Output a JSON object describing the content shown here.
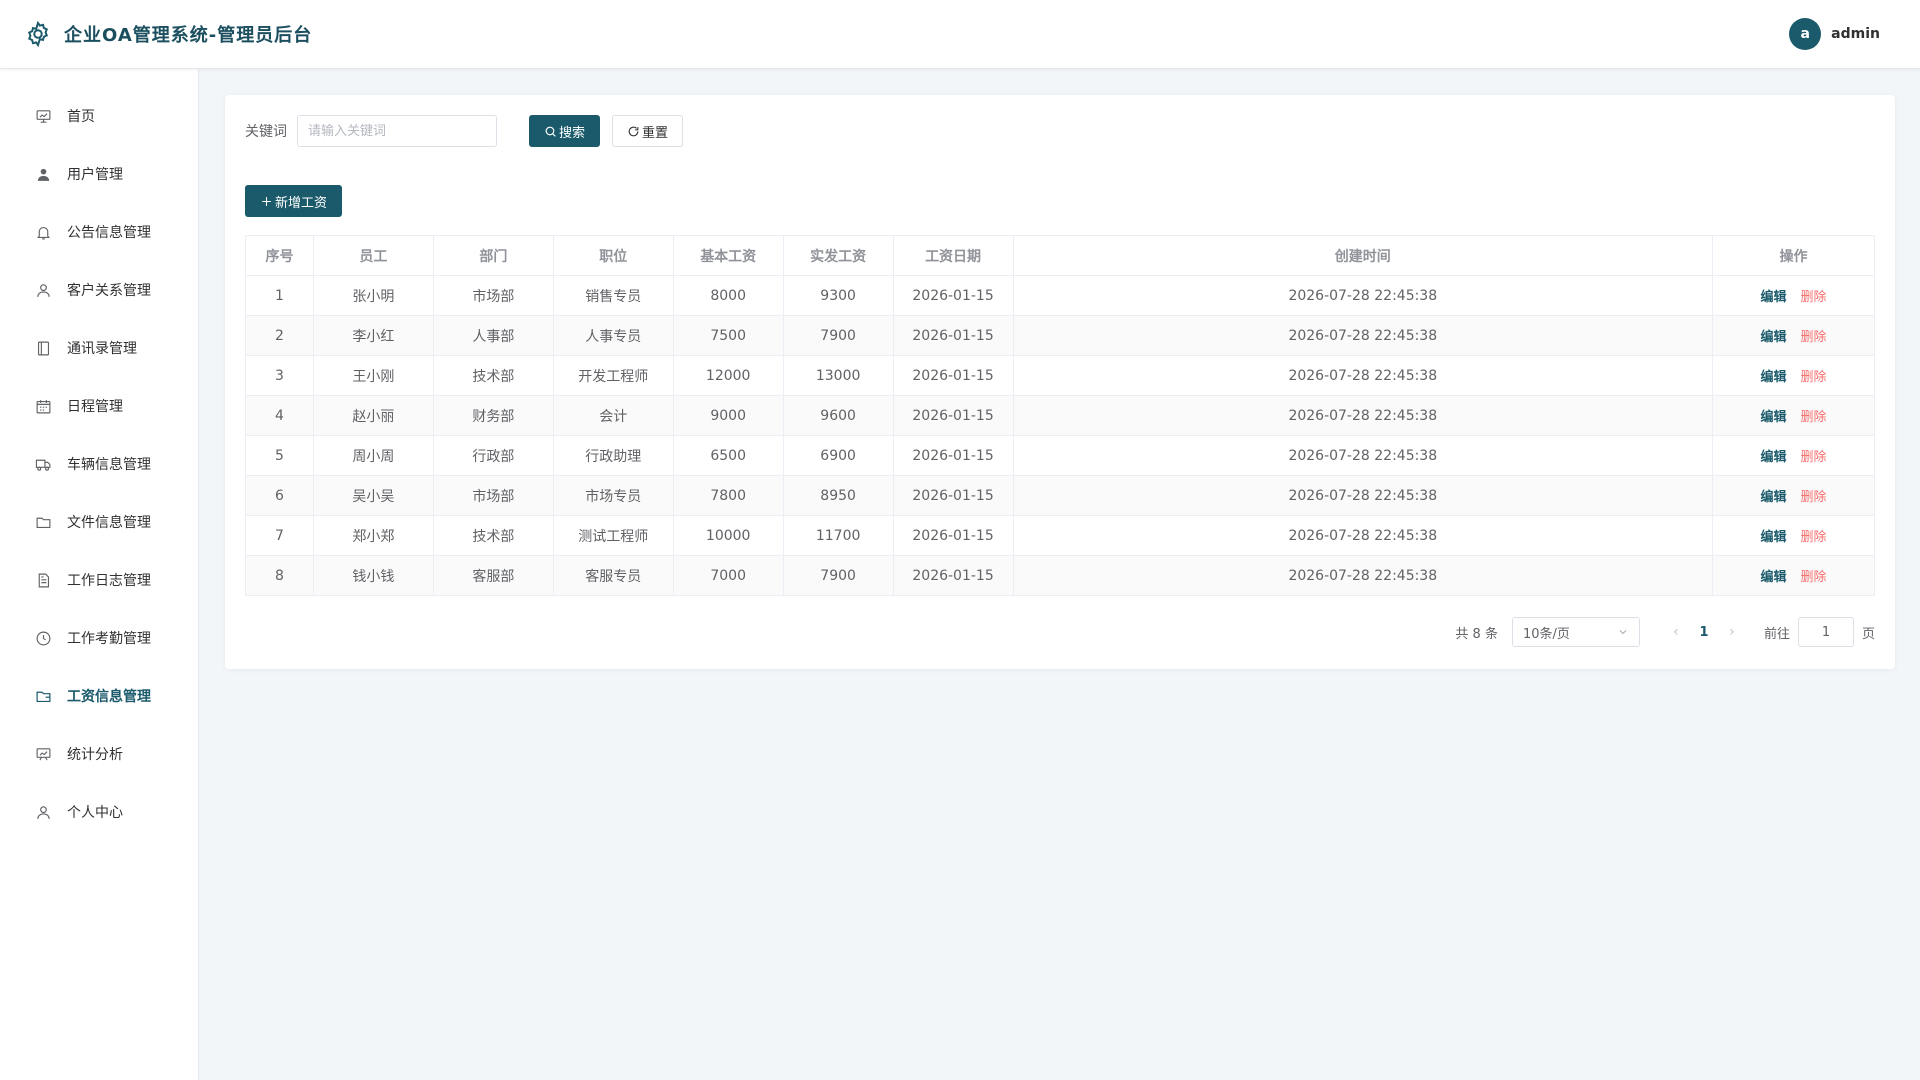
{
  "header": {
    "title": "企业OA管理系统-管理员后台",
    "avatar_letter": "a",
    "username": "admin"
  },
  "sidebar": {
    "items": [
      {
        "label": "首页",
        "icon": "dashboard-icon"
      },
      {
        "label": "用户管理",
        "icon": "user-icon"
      },
      {
        "label": "公告信息管理",
        "icon": "bell-icon"
      },
      {
        "label": "客户关系管理",
        "icon": "person-icon"
      },
      {
        "label": "通讯录管理",
        "icon": "notebook-icon"
      },
      {
        "label": "日程管理",
        "icon": "calendar-icon"
      },
      {
        "label": "车辆信息管理",
        "icon": "truck-icon"
      },
      {
        "label": "文件信息管理",
        "icon": "folder-icon"
      },
      {
        "label": "工作日志管理",
        "icon": "document-icon"
      },
      {
        "label": "工作考勤管理",
        "icon": "clock-icon"
      },
      {
        "label": "工资信息管理",
        "icon": "wallet-folder-icon",
        "active": true
      },
      {
        "label": "统计分析",
        "icon": "chart-board-icon"
      },
      {
        "label": "个人中心",
        "icon": "profile-icon"
      }
    ]
  },
  "search": {
    "label": "关键词",
    "placeholder": "请输入关键词",
    "value": "",
    "search_label": "搜索",
    "reset_label": "重置"
  },
  "toolbar": {
    "add_label": "新增工资"
  },
  "table": {
    "columns": [
      "序号",
      "员工",
      "部门",
      "职位",
      "基本工资",
      "实发工资",
      "工资日期",
      "创建时间",
      "操作"
    ],
    "edit_label": "编辑",
    "delete_label": "删除",
    "rows": [
      [
        "1",
        "张小明",
        "市场部",
        "销售专员",
        "8000",
        "9300",
        "2026-01-15",
        "2026-07-28 22:45:38"
      ],
      [
        "2",
        "李小红",
        "人事部",
        "人事专员",
        "7500",
        "7900",
        "2026-01-15",
        "2026-07-28 22:45:38"
      ],
      [
        "3",
        "王小刚",
        "技术部",
        "开发工程师",
        "12000",
        "13000",
        "2026-01-15",
        "2026-07-28 22:45:38"
      ],
      [
        "4",
        "赵小丽",
        "财务部",
        "会计",
        "9000",
        "9600",
        "2026-01-15",
        "2026-07-28 22:45:38"
      ],
      [
        "5",
        "周小周",
        "行政部",
        "行政助理",
        "6500",
        "6900",
        "2026-01-15",
        "2026-07-28 22:45:38"
      ],
      [
        "6",
        "吴小吴",
        "市场部",
        "市场专员",
        "7800",
        "8950",
        "2026-01-15",
        "2026-07-28 22:45:38"
      ],
      [
        "7",
        "郑小郑",
        "技术部",
        "测试工程师",
        "10000",
        "11700",
        "2026-01-15",
        "2026-07-28 22:45:38"
      ],
      [
        "8",
        "钱小钱",
        "客服部",
        "客服专员",
        "7000",
        "7900",
        "2026-01-15",
        "2026-07-28 22:45:38"
      ]
    ]
  },
  "pagination": {
    "total_text": "共 8 条",
    "page_size": "10条/页",
    "current_page": "1",
    "goto_label": "前往",
    "goto_value": "1",
    "page_suffix": "页"
  },
  "colors": {
    "primary": "#1b5a6b",
    "danger": "#f56c6c",
    "background": "#f3f6f9"
  }
}
